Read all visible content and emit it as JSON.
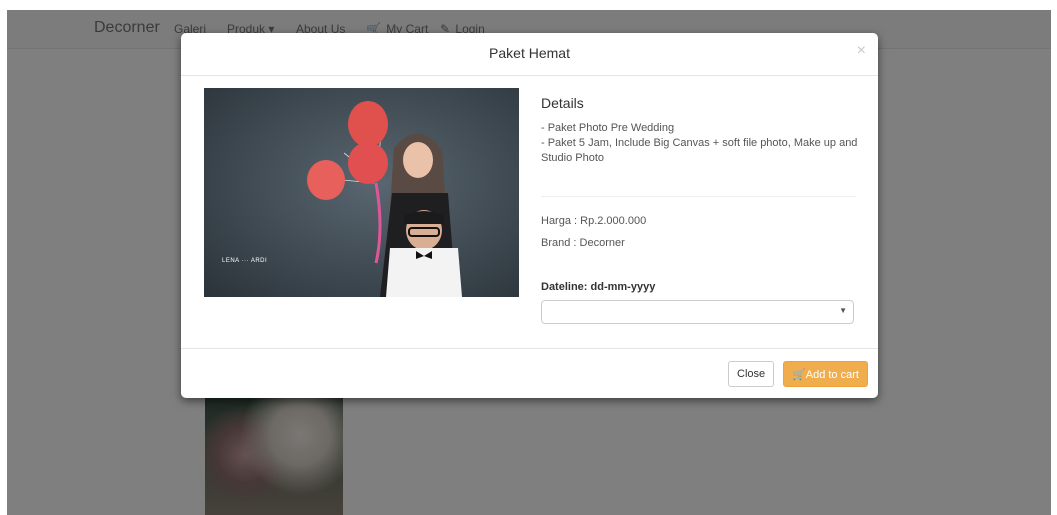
{
  "navbar": {
    "brand": "Decorner",
    "items": [
      {
        "label": "Galeri",
        "icon": ""
      },
      {
        "label": "Produk",
        "icon": "caret-down"
      },
      {
        "label": "About Us",
        "icon": ""
      },
      {
        "label": "My Cart",
        "icon": "cart-icon"
      },
      {
        "label": "Login",
        "icon": "pencil-icon"
      }
    ]
  },
  "modal": {
    "title": "Paket Hemat",
    "close_symbol": "×",
    "details_heading": "Details",
    "details_lines": [
      "- Paket Photo Pre Wedding",
      "- Paket 5 Jam, Include Big Canvas + soft file photo, Make up and Studio Photo"
    ],
    "price": "Harga : Rp.2.000.000",
    "brand": "Brand : Decorner",
    "dateline_label": "Dateline: dd-mm-yyyy",
    "dateline_selected": "",
    "photo_watermark": "LENA ··· ARDI",
    "footer": {
      "close_label": "Close",
      "add_to_cart_label": "Add to cart"
    }
  },
  "colors": {
    "accent": "#f0ad4e",
    "backdrop": "rgba(0,0,0,0.5)"
  }
}
